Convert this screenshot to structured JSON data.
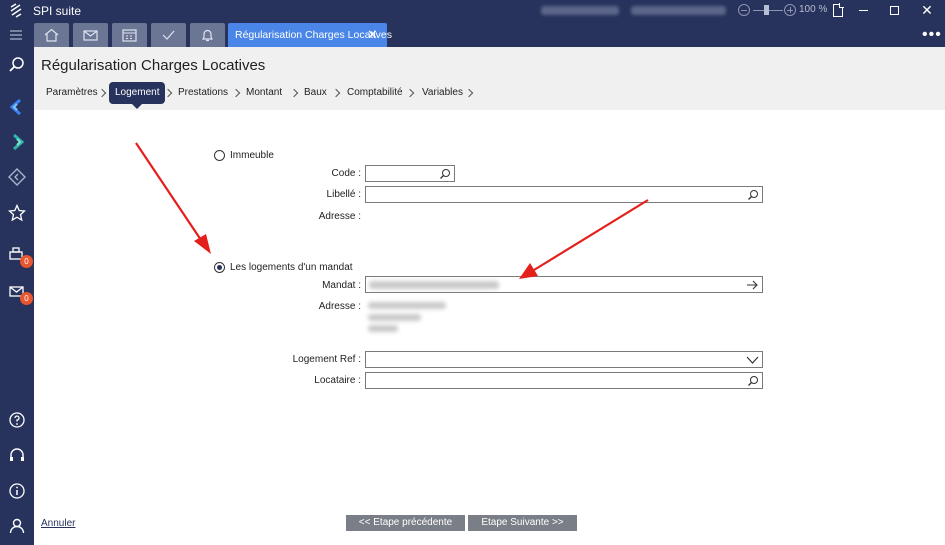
{
  "app": {
    "title": "SPI suite",
    "zoom": "100 %"
  },
  "tabs": {
    "active_label": "Régularisation Charges Locatives"
  },
  "sidebar": {
    "print_badge": "0",
    "mail_badge": "0"
  },
  "header": {
    "title": "Régularisation Charges Locatives",
    "steps": [
      "Paramètres",
      "Logement",
      "Prestations",
      "Montant",
      "Baux",
      "Comptabilité",
      "Variables"
    ],
    "active_step": "Logement"
  },
  "form": {
    "radio_immeuble": "Immeuble",
    "code_label": "Code :",
    "libelle_label": "Libellé :",
    "adresse_label": "Adresse :",
    "radio_mandat": "Les logements d'un mandat",
    "mandat_label": "Mandat :",
    "adresse2_label": "Adresse :",
    "logement_ref_label": "Logement Ref :",
    "locataire_label": "Locataire :"
  },
  "footer": {
    "cancel": "Annuler",
    "prev": "<< Etape précédente",
    "next": "Etape Suivante >>"
  },
  "colors": {
    "navy": "#27335c",
    "accent": "#4a86e8",
    "badge": "#e8552f",
    "arrow": "#e3201b"
  }
}
